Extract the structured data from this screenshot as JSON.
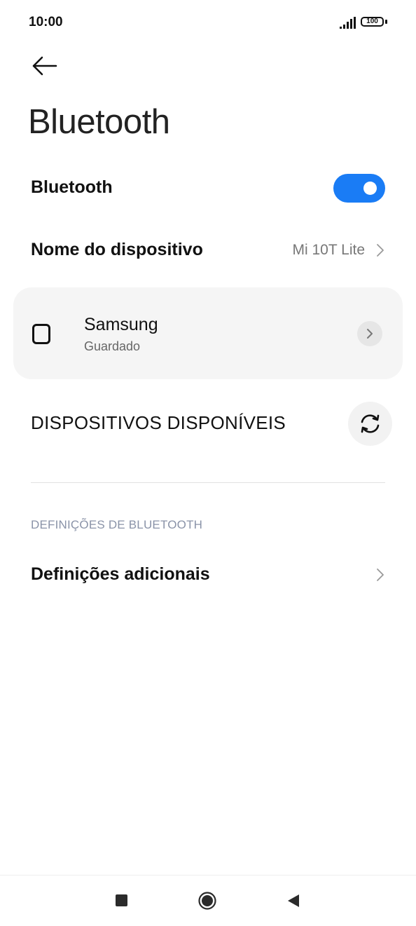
{
  "status_bar": {
    "time": "10:00",
    "battery": "100",
    "icons": [
      "signal-icon",
      "battery-icon"
    ]
  },
  "header": {
    "back_icon": "back-arrow-icon",
    "title": "Bluetooth"
  },
  "bluetooth_toggle": {
    "label": "Bluetooth",
    "enabled": true
  },
  "device_name": {
    "label": "Nome do dispositivo",
    "value": "Mi 10T Lite"
  },
  "saved_device": {
    "name": "Samsung",
    "status": "Guardado",
    "icon": "phone-device-icon"
  },
  "available": {
    "heading": "DISPOSITIVOS DISPONÍVEIS",
    "refresh_icon": "refresh-icon"
  },
  "settings_section": {
    "heading": "DEFINIÇÕES DE BLUETOOTH",
    "additional_label": "Definições adicionais"
  },
  "nav_bar": {
    "icons": [
      "recents-icon",
      "home-icon",
      "back-icon"
    ]
  },
  "colors": {
    "accent": "#1a7cf5",
    "card_bg": "#f5f5f5",
    "subheading": "#8a93a8"
  }
}
